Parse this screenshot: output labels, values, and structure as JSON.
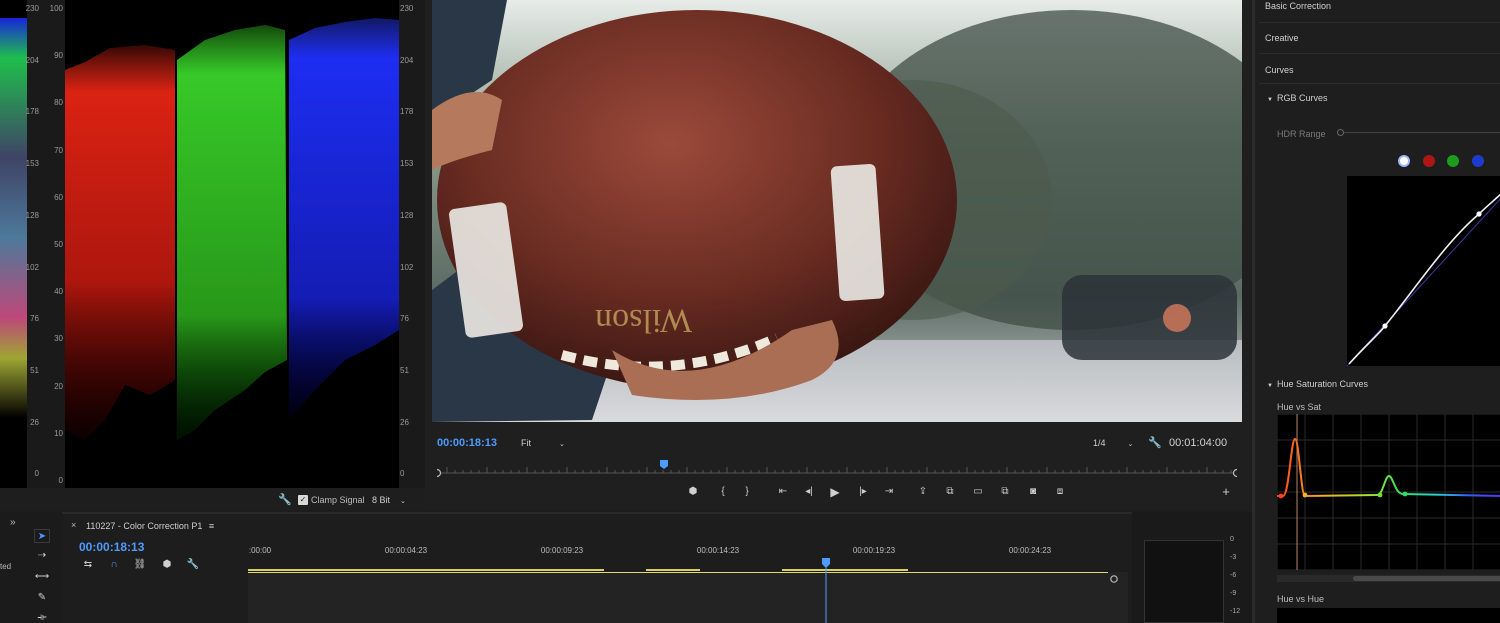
{
  "scopes": {
    "scale_inner": [
      "230",
      "204",
      "178",
      "153",
      "128",
      "102",
      "76",
      "51",
      "26",
      "0"
    ],
    "scale_ire": [
      "100",
      "90",
      "80",
      "70",
      "60",
      "50",
      "40",
      "30",
      "20",
      "10",
      "0"
    ],
    "scale_right": [
      "230",
      "204",
      "178",
      "153",
      "128",
      "102",
      "76",
      "51",
      "26",
      "0"
    ],
    "clamp_label": "Clamp Signal",
    "bit_depth": "8 Bit",
    "parade_colors": [
      "#e02818",
      "#3dd62a",
      "#1f3cff"
    ]
  },
  "program": {
    "current_timecode": "00:00:18:13",
    "zoom": "Fit",
    "resolution": "1/4",
    "duration": "00:01:04:00"
  },
  "lumetri": {
    "sections": {
      "basic": "Basic Correction",
      "creative": "Creative",
      "curves": "Curves"
    },
    "rgb_curves": "RGB Curves",
    "hdr_range": "HDR Range",
    "channels": [
      "#ffffff",
      "#b01515",
      "#1e9b1e",
      "#1e3ccc"
    ],
    "hue_sat_curves": "Hue Saturation Curves",
    "hue_vs_sat": "Hue vs Sat",
    "hue_vs_hue": "Hue vs Hue"
  },
  "timeline": {
    "panel_menu": "»",
    "sequence_tab": "110227 - Color Correction P1",
    "timecode": "00:00:18:13",
    "ruler": [
      ":00:00",
      "00:00:04:23",
      "00:00:09:23",
      "00:00:14:23",
      "00:00:19:23",
      "00:00:24:23"
    ],
    "meter_scale": [
      "0",
      "-3",
      "-6",
      "-9",
      "-12"
    ],
    "left_edge_text": "ted"
  }
}
